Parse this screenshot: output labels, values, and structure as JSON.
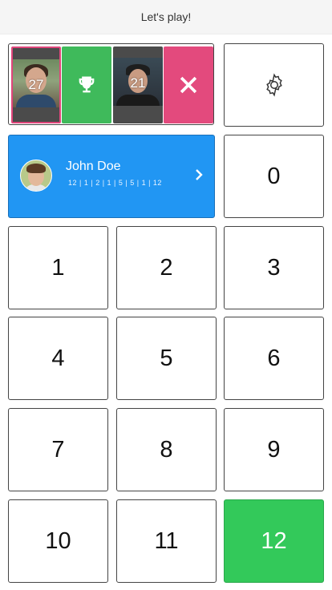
{
  "header": {
    "title": "Let's play!"
  },
  "players": [
    {
      "score": "27",
      "selected": true
    },
    {
      "score": "21",
      "selected": false
    }
  ],
  "icons": {
    "trophy": "trophy-icon",
    "close": "close-icon",
    "settings": "gear-icon",
    "chevron": "chevron-right-icon"
  },
  "current_player": {
    "name": "John Doe",
    "history": "12 | 1 | 2 | 1 | 5 | 5 | 1 | 12"
  },
  "keypad": {
    "zero": "0",
    "keys": [
      "1",
      "2",
      "3",
      "4",
      "5",
      "6",
      "7",
      "8",
      "9",
      "10",
      "11",
      "12"
    ],
    "selected": "12"
  },
  "colors": {
    "accent_blue": "#2196f3",
    "win_green": "#3fba5b",
    "selected_key_green": "#33c95a",
    "close_pink": "#e34a7d",
    "selection_border": "#e0457b"
  }
}
